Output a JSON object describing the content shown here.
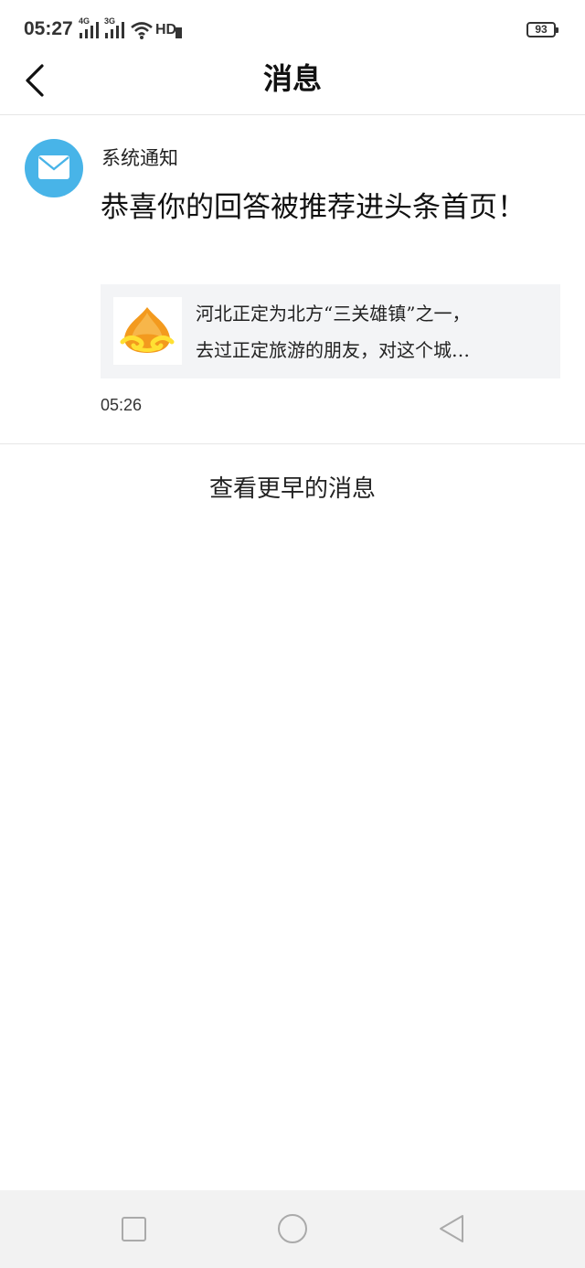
{
  "status_bar": {
    "time": "05:27",
    "network_1": "4G",
    "network_2": "3G",
    "hd_label": "HD",
    "battery": "93"
  },
  "nav": {
    "title": "消息"
  },
  "message": {
    "sender": "系统通知",
    "title": "恭喜你的回答被推荐进头条首页！",
    "preview_line_1": "河北正定为北方“三关雄镇”之一，",
    "preview_line_2": "去过正定旅游的朋友，对这个城…",
    "time": "05:26"
  },
  "load_earlier_label": "查看更早的消息",
  "icons": {
    "back": "chevron-left-icon",
    "avatar": "mail-icon",
    "thumb": "logo-icon",
    "sys_recent": "square-icon",
    "sys_home": "circle-icon",
    "sys_back": "triangle-icon"
  },
  "colors": {
    "avatar_bg": "#48b4e8",
    "card_bg": "#f3f4f6",
    "system_nav_bg": "#f2f2f2"
  }
}
